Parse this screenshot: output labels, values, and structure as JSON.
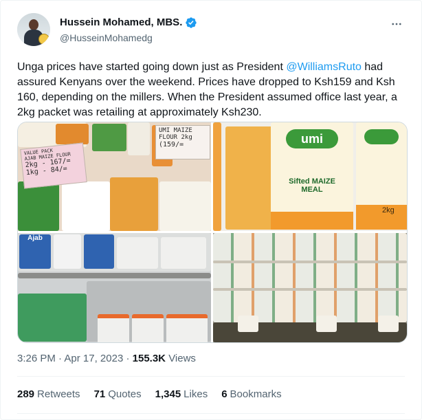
{
  "author": {
    "display_name": "Hussein Mohamed, MBS.",
    "handle": "@HusseinMohamedg",
    "verified": true
  },
  "tweet": {
    "text_before": "Unga prices have started going down just as President ",
    "mention": "@WilliamsRuto",
    "text_after": " had assured Kenyans over the weekend. Prices have dropped to Ksh159 and Ksh 160, depending on the millers. When the President assumed office last year, a 2kg packet was retailing at approximately Ksh230."
  },
  "media": {
    "images": [
      {
        "alt": "Photo 1",
        "labels": [
          "VALUE PACK",
          "AJAB MAIZE FLOUR",
          "2kg - 167/=",
          "1kg - 84/=",
          "UMI MAIZE FLOUR 2kg",
          "(159/="
        ]
      },
      {
        "alt": "Photo 2",
        "labels": [
          "umi",
          "Sifted MAIZE MEAL",
          "2kg"
        ]
      },
      {
        "alt": "Photo 3",
        "labels": [
          "Ajab"
        ]
      },
      {
        "alt": "Photo 4",
        "labels": []
      }
    ]
  },
  "meta": {
    "time": "3:26 PM",
    "separator": " · ",
    "date": "Apr 17, 2023",
    "views_count": "155.3K",
    "views_label": "Views"
  },
  "stats": {
    "retweets": {
      "count": "289",
      "label": "Retweets"
    },
    "quotes": {
      "count": "71",
      "label": "Quotes"
    },
    "likes": {
      "count": "1,345",
      "label": "Likes"
    },
    "bookmarks": {
      "count": "6",
      "label": "Bookmarks"
    }
  },
  "colors": {
    "accent": "#1d9bf0",
    "text_primary": "#0f1419",
    "text_secondary": "#536471"
  },
  "icons": {
    "verified": "verified-badge-icon",
    "more": "more-options-icon"
  }
}
